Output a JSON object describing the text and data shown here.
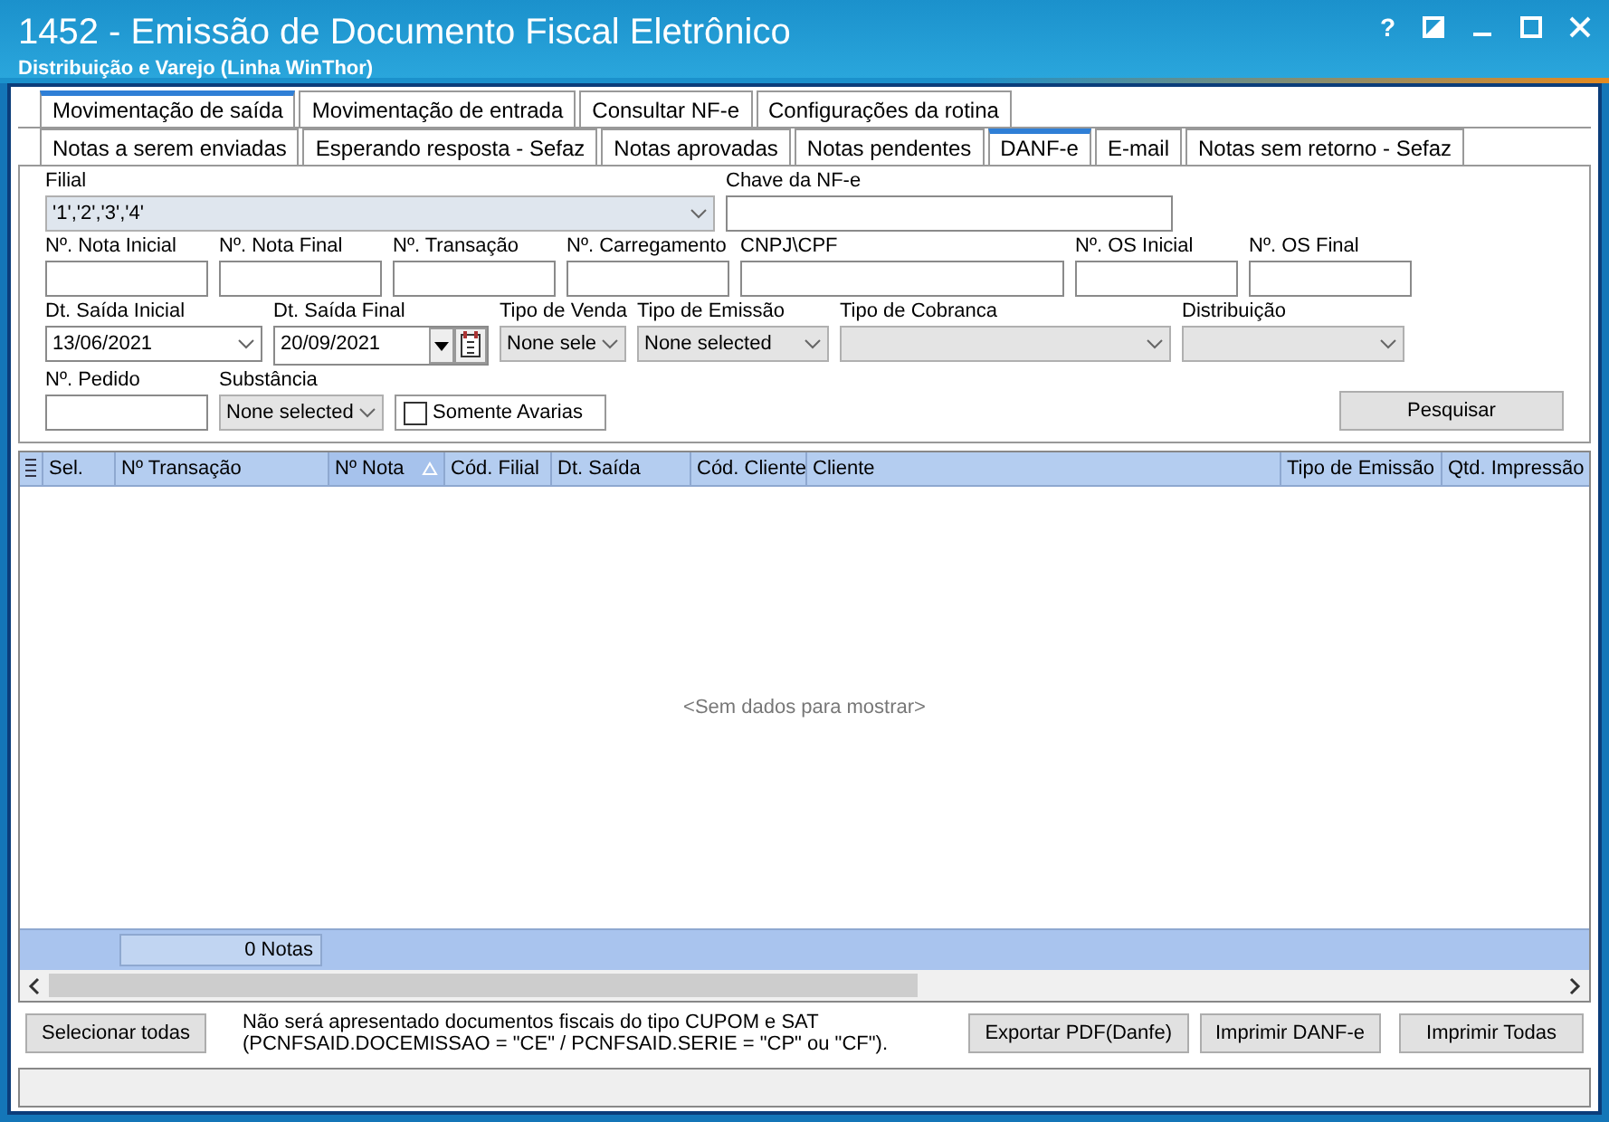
{
  "window": {
    "title": "1452 - Emissão de Documento Fiscal Eletrônico",
    "subtitle": "Distribuição e Varejo (Linha WinThor)",
    "help": "?"
  },
  "main_tabs": [
    {
      "label": "Movimentação de saída",
      "selected": true
    },
    {
      "label": "Movimentação de entrada",
      "selected": false
    },
    {
      "label": "Consultar NF-e",
      "selected": false
    },
    {
      "label": "Configurações da rotina",
      "selected": false
    }
  ],
  "sub_tabs": [
    {
      "label": "Notas a serem enviadas",
      "selected": false
    },
    {
      "label": "Esperando resposta - Sefaz",
      "selected": false
    },
    {
      "label": "Notas aprovadas",
      "selected": false
    },
    {
      "label": "Notas pendentes",
      "selected": false
    },
    {
      "label": "DANF-e",
      "selected": true
    },
    {
      "label": "E-mail",
      "selected": false
    },
    {
      "label": "Notas sem retorno - Sefaz",
      "selected": false
    }
  ],
  "filter_rows": [
    [
      {
        "kind": "combo",
        "label": "Filial",
        "value": "'1','2','3','4'"
      },
      {
        "kind": "text",
        "label": "Chave da NF-e"
      }
    ],
    [
      {
        "kind": "text",
        "label": "Nº. Nota Inicial"
      },
      {
        "kind": "text",
        "label": "Nº. Nota Final"
      },
      {
        "kind": "text",
        "label": "Nº. Transação"
      },
      {
        "kind": "text",
        "label": "Nº. Carregamento"
      },
      {
        "kind": "text",
        "label": "CNPJ\\CPF"
      },
      {
        "kind": "text",
        "label": "Nº. OS Inicial"
      },
      {
        "kind": "text",
        "label": "Nº. OS Final"
      }
    ],
    [
      {
        "kind": "date-combo",
        "label": "Dt. Saída Inicial",
        "value": "13/06/2021"
      },
      {
        "kind": "date-picker",
        "label": "Dt. Saída Final",
        "value": "20/09/2021"
      },
      {
        "kind": "combo",
        "label": "Tipo de Venda",
        "value": "None sele"
      },
      {
        "kind": "combo",
        "label": "Tipo de Emissão",
        "value": "None selected"
      },
      {
        "kind": "combo",
        "label": "Tipo de Cobranca"
      },
      {
        "kind": "combo",
        "label": "Distribuição"
      }
    ],
    [
      {
        "kind": "text",
        "label": "Nº. Pedido"
      },
      {
        "kind": "combo",
        "label": "Substância",
        "value": "None selected"
      },
      {
        "kind": "checkbox",
        "label": "Somente Avarias",
        "checked": false
      },
      {
        "kind": "button",
        "label": "Pesquisar"
      }
    ]
  ],
  "table": {
    "columns": [
      {
        "label": "Sel.",
        "sorted": false
      },
      {
        "label": "Nº Transação",
        "sorted": false
      },
      {
        "label": "Nº Nota",
        "sorted": true
      },
      {
        "label": "Cód. Filial",
        "sorted": false
      },
      {
        "label": "Dt. Saída",
        "sorted": false
      },
      {
        "label": "Cód. Cliente",
        "sorted": false
      },
      {
        "label": "Cliente",
        "sorted": false
      },
      {
        "label": "Tipo de Emissão",
        "sorted": false
      },
      {
        "label": "Qtd. Impressão",
        "sorted": false
      }
    ],
    "empty_text": "<Sem dados para mostrar>",
    "summary": "0 Notas"
  },
  "bottom": {
    "select_all": "Selecionar todas",
    "note": [
      "Não será apresentado documentos fiscais do tipo CUPOM e SAT",
      "(PCNFSAID.DOCEMISSAO = \"CE\" / PCNFSAID.SERIE = \"CP\" ou \"CF\")."
    ],
    "buttons": [
      "Exportar PDF(Danfe)",
      "Imprimir DANF-e",
      "Imprimir Todas"
    ]
  }
}
